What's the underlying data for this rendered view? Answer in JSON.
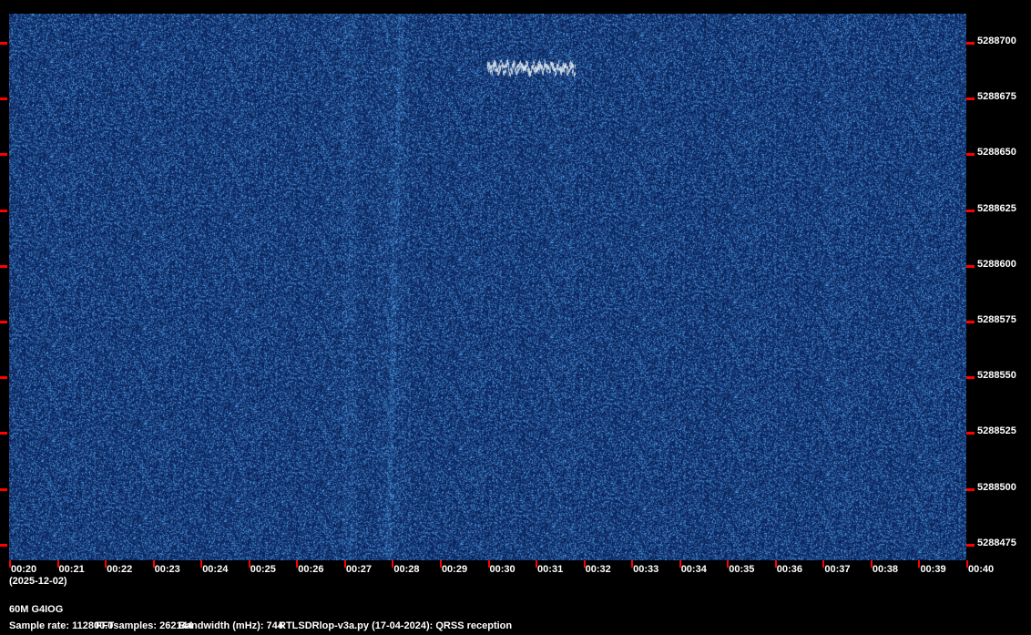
{
  "chart_data": {
    "type": "heatmap",
    "title": "60M G4IOG",
    "date": "(2025-12-02)",
    "x_tick_labels": [
      "00:20",
      "00:21",
      "00:22",
      "00:23",
      "00:24",
      "00:25",
      "00:26",
      "00:27",
      "00:28",
      "00:29",
      "00:30",
      "00:31",
      "00:32",
      "00:33",
      "00:34",
      "00:35",
      "00:36",
      "00:37",
      "00:38",
      "00:39",
      "00:40"
    ],
    "y_tick_labels": [
      "5288700",
      "5288675",
      "5288650",
      "5288625",
      "5288600",
      "5288575",
      "5288550",
      "5288525",
      "5288500",
      "5288475"
    ],
    "y_range_hz": [
      5288468,
      5288713
    ],
    "x_range": [
      "00:20",
      "00:40"
    ],
    "signals": [
      {
        "type": "qrss-trace",
        "time_start": "00:30",
        "time_end": "00:31.8",
        "freq_hz": 5288692
      }
    ],
    "colors": {
      "background": "#0b2560",
      "noise_bright": "#3f7fc0",
      "signal": "#d8e4ee",
      "tick": "#ff0000"
    }
  },
  "footer": {
    "station": "60M G4IOG",
    "sample_rate": "Sample rate: 112800.0",
    "fft_samples": "FFTsamples: 262144",
    "bandwidth": "Bandwidth (mHz): 744",
    "program": "RTLSDRlop-v3a.py (17-04-2024): QRSS reception"
  }
}
